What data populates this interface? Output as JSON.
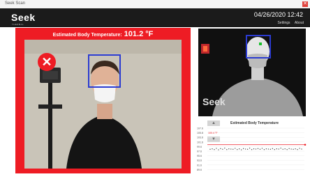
{
  "window": {
    "title": "Seek Scan",
    "close_glyph": "✕"
  },
  "header": {
    "logo": "Seek",
    "logo_sub": "THERMAL",
    "datetime": "04/26/2020 12:42",
    "links": {
      "settings": "Settings",
      "about": "About"
    }
  },
  "visible": {
    "temperature_label": "Estimated Body Temperature:",
    "temperature_value": "101.2 °F",
    "status_glyph": "✕"
  },
  "thermal": {
    "watermark": "Seek"
  },
  "controls": {
    "up_glyph": "▲",
    "down_glyph": "▼"
  },
  "colors": {
    "alarm": "#ee1c24",
    "header": "#1b1b1b",
    "box": "#2b3bd1"
  },
  "chart_data": {
    "type": "scatter",
    "title": "Estimated Body Temperature",
    "highlight_label": "100.4 °F",
    "yticks": [
      "107.6",
      "105.8",
      "103.6",
      "101.6",
      "99.6",
      "97.6",
      "95.6",
      "93.6",
      "91.6",
      "89.6"
    ],
    "threshold": 100.4,
    "values": [
      98.4,
      98.6,
      98.3,
      98.8,
      98.2,
      98.7,
      98.4,
      98.9,
      98.3,
      98.6,
      98.5,
      98.4,
      98.8,
      98.3,
      98.6,
      98.2,
      98.7,
      98.5,
      98.4,
      98.9,
      98.3,
      98.6,
      98.5,
      98.7,
      98.4,
      98.8,
      98.3,
      98.6,
      98.5,
      98.4,
      98.7,
      98.3,
      98.6,
      98.5,
      98.9,
      98.4,
      98.6,
      98.3,
      98.7,
      98.5,
      98.4,
      98.6,
      98.3,
      98.8,
      98.5
    ]
  }
}
